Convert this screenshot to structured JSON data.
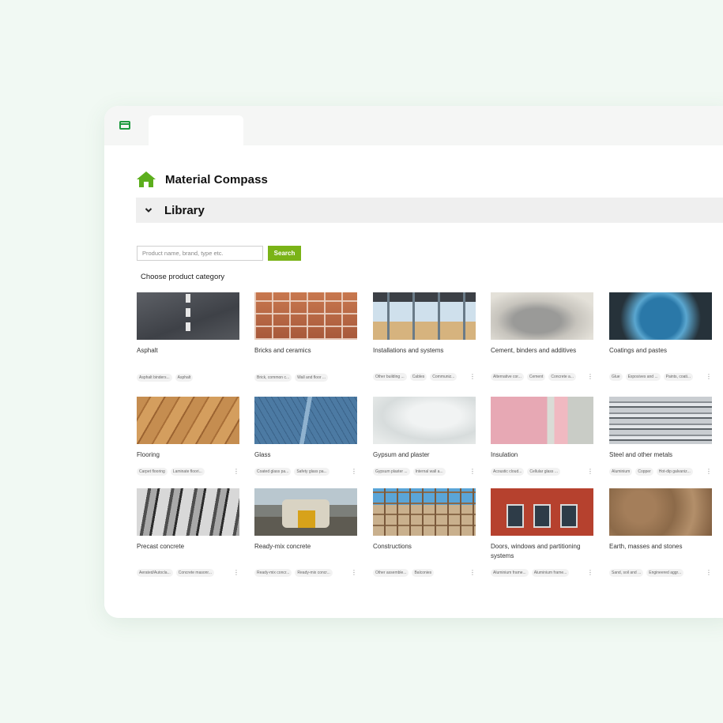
{
  "header": {
    "title": "Material Compass",
    "home_icon": "home-icon"
  },
  "library": {
    "label": "Library",
    "icon": "chevron-down-icon"
  },
  "search": {
    "placeholder": "Product name, brand, type etc.",
    "value": "",
    "button_label": "Search"
  },
  "category_prompt": "Choose product category",
  "colors": {
    "accent": "#7ab317",
    "app_icon": "#1e9a3f",
    "home_icon": "#5cae1d"
  },
  "categories": [
    {
      "name": "Asphalt",
      "tags": [
        "Asphalt binders...",
        "Asphalt"
      ],
      "more": ""
    },
    {
      "name": "Bricks and ceramics",
      "tags": [
        "Brick, common c...",
        "Wall and floor ..."
      ],
      "more": ""
    },
    {
      "name": "Installations and systems",
      "tags": [
        "Other building ...",
        "Cables",
        "Communiz..."
      ],
      "more": "⋮"
    },
    {
      "name": "Cement, binders and additives",
      "tags": [
        "Alternative cor...",
        "Cement",
        "Concrete a..."
      ],
      "more": "⋮"
    },
    {
      "name": "Coatings and pastes",
      "tags": [
        "Glue",
        "Exposives and ...",
        "Paints, coati..."
      ],
      "more": "⋮"
    },
    {
      "name": "Flooring",
      "tags": [
        "Carpet flooring",
        "Laminate floori..."
      ],
      "more": "⋮"
    },
    {
      "name": "Glass",
      "tags": [
        "Coated glass pa...",
        "Safety glass pa..."
      ],
      "more": "⋮"
    },
    {
      "name": "Gypsum and plaster",
      "tags": [
        "Gypsum plaster ...",
        "Internal wall a..."
      ],
      "more": "⋮"
    },
    {
      "name": "Insulation",
      "tags": [
        "Acoustic cloud...",
        "Cellular glass ..."
      ],
      "more": "⋮"
    },
    {
      "name": "Steel and other metals",
      "tags": [
        "Aluminium",
        "Copper",
        "Hot-dip galvaniz..."
      ],
      "more": "⋮"
    },
    {
      "name": "Precast concrete",
      "tags": [
        "Aerated/Autocla...",
        "Concrete masonr..."
      ],
      "more": "⋮"
    },
    {
      "name": "Ready-mix concrete",
      "tags": [
        "Ready-mix concr...",
        "Ready-mix concr..."
      ],
      "more": "⋮"
    },
    {
      "name": "Constructions",
      "tags": [
        "Other assemble...",
        "Balconies"
      ],
      "more": "⋮"
    },
    {
      "name": "Doors, windows and partitioning systems",
      "tags": [
        "Aluminium frame...",
        "Aluminium frame..."
      ],
      "more": "⋮"
    },
    {
      "name": "Earth, masses and stones",
      "tags": [
        "Sand, soil and ...",
        "Engineered aggr..."
      ],
      "more": "⋮"
    }
  ]
}
